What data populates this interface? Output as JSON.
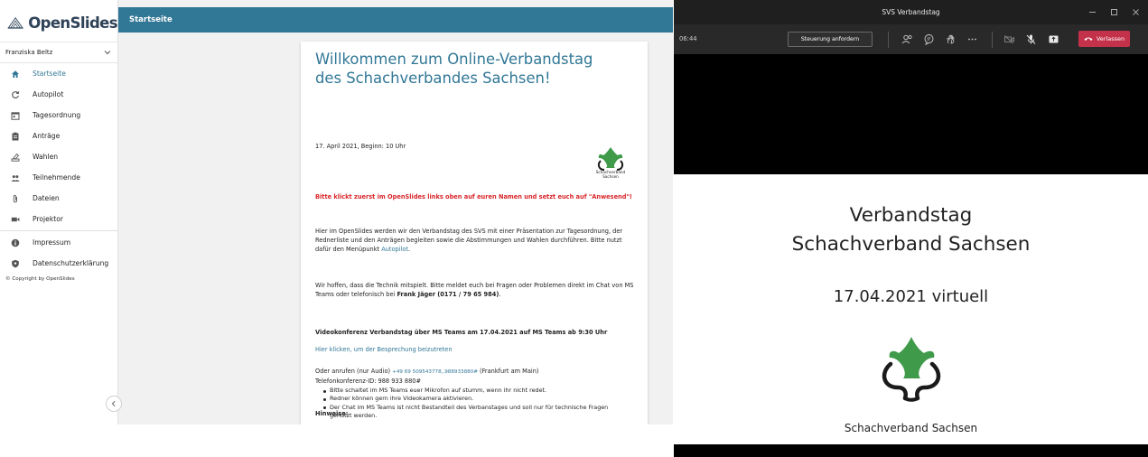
{
  "openslides": {
    "brand": "OpenSlides",
    "user_name": "Franziska Beltz",
    "topbar_title": "Startseite",
    "nav": [
      {
        "label": "Startseite",
        "icon": "home-icon",
        "active": true
      },
      {
        "label": "Autopilot",
        "icon": "autopilot-icon"
      },
      {
        "label": "Tagesordnung",
        "icon": "calendar-icon"
      },
      {
        "label": "Anträge",
        "icon": "clipboard-icon"
      },
      {
        "label": "Wahlen",
        "icon": "ballot-icon"
      },
      {
        "label": "Teilnehmende",
        "icon": "people-icon"
      },
      {
        "label": "Dateien",
        "icon": "paperclip-icon"
      },
      {
        "label": "Projektor",
        "icon": "videocam-icon"
      },
      {
        "label": "Impressum",
        "icon": "info-icon"
      },
      {
        "label": "Datenschutzerklärung",
        "icon": "shield-icon"
      }
    ],
    "copyright": "© Copyright by OpenSlides",
    "page": {
      "title": "Willkommen zum Online-Verbandstag des Schachverbandes Sachsen!",
      "date": "17. April 2021, Beginn: 10 Uhr",
      "logo_text": "Schachverband Sachsen",
      "warning": "Bitte klickt zuerst im OpenSlides links oben auf euren Namen und setzt euch auf \"Anwesend\"!",
      "intro_1": "Hier im OpenSlides werden wir den Verbandstag des SVS mit einer Präsentation zur Tagesordnung, der Rednerliste und den Anträgen begleiten sowie die Abstimmungen und Wahlen durchführen. Bitte nutzt dafür den Menüpunkt ",
      "intro_link": "Autopilot",
      "intro_2": ".",
      "tech_1": "Wir hoffen, dass die Technik mitspielt. Bitte meldet euch bei Fragen oder Problemen direkt im Chat von MS Teams oder telefonisch bei ",
      "tech_name": "Frank Jäger (0171 /  79 65 984)",
      "tech_2": ".",
      "video_heading": "Videokonferenz Verbandstag über MS Teams am 17.04.2021 auf MS Teams ab 9:30 Uhr",
      "join_link": "Hier klicken, um der Besprechung beizutreten",
      "phone_prefix": "Oder anrufen (nur Audio) ",
      "phone_number": "+49 69 509543778,,988933880#",
      "phone_suffix": " (Frankfurt am Main)",
      "conference_id": "Telefonkonferenz-ID: 988 933 880#",
      "hints_heading": "Hinweise:",
      "hints": [
        "Bitte schaltet im MS Teams euer Mikrofon auf stumm, wenn ihr nicht redet.",
        "Redner können gern ihre Videokamera aktivieren.",
        "Der Chat im MS Teams ist nicht Bestandteil des Verbanstages und soll nur für technische Fragen genutzt werden."
      ]
    }
  },
  "teams": {
    "window_title": "SVS Verbandstag",
    "time": "06:44",
    "control_button": "Steuerung anfordern",
    "leave_button": "Verlassen",
    "toolbar_icons": [
      "participants-icon",
      "chat-icon",
      "raise-hand-icon",
      "more-icon",
      "camera-off-icon",
      "mic-off-icon",
      "share-icon"
    ],
    "slide": {
      "title_line_1": "Verbandstag",
      "title_line_2": "Schachverband Sachsen",
      "date": "17.04.2021 virtuell",
      "org": "Schachverband Sachsen"
    }
  },
  "colors": {
    "brand": "#317796",
    "warning": "#d9262a",
    "leave": "#c4314b",
    "logo_green": "#3f9a4a"
  }
}
